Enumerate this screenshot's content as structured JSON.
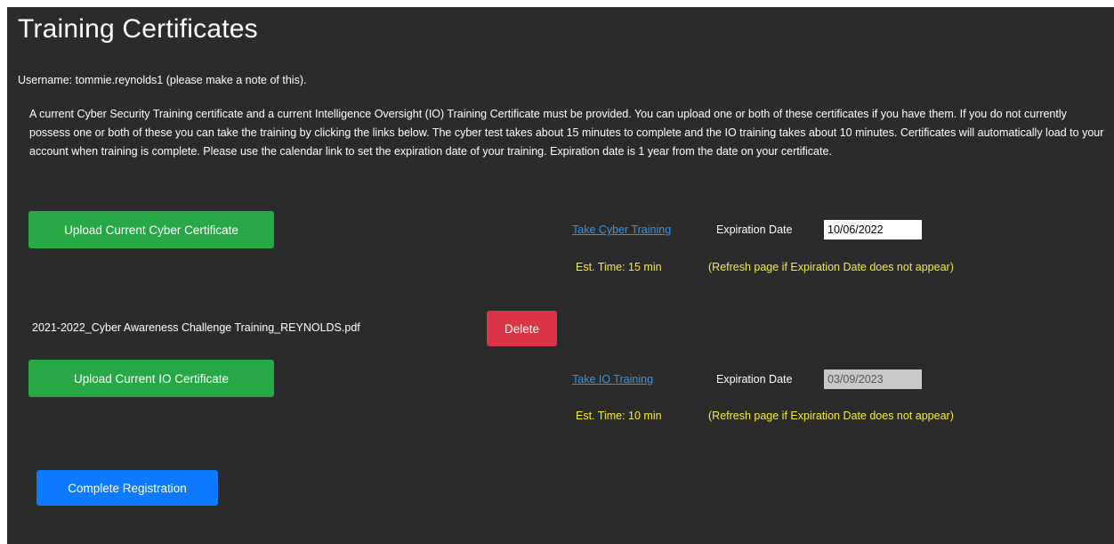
{
  "page": {
    "title": "Training Certificates",
    "username_text": "Username: tommie.reynolds1 (please make a note of this).",
    "description": "A current Cyber Security Training certificate and a current Intelligence Oversight (IO) Training Certificate must be provided. You can upload one or both of these certificates if you have them. If you do not currently possess one or both of these you can take the training by clicking the links below. The cyber test takes about 15 minutes to complete and the IO training takes about 10 minutes. Certificates will automatically load to your account when training is complete. Please use the calendar link to set the expiration date of your training. Expiration date is 1 year from the date on your certificate."
  },
  "cyber": {
    "upload_label": "Upload Current Cyber Certificate",
    "training_link": "Take Cyber Training",
    "expiration_label": "Expiration Date",
    "expiration_value": "10/06/2022",
    "est_time": "Est. Time: 15 min",
    "refresh_note": "(Refresh page if Expiration Date does not appear)",
    "uploaded_file": "2021-2022_Cyber Awareness Challenge Training_REYNOLDS.pdf",
    "delete_label": "Delete"
  },
  "io": {
    "upload_label": "Upload Current IO Certificate",
    "training_link": "Take IO Training",
    "expiration_label": "Expiration Date",
    "expiration_value": "03/09/2023",
    "est_time": "Est. Time: 10 min",
    "refresh_note": "(Refresh page if Expiration Date does not appear)"
  },
  "footer": {
    "complete_label": "Complete Registration"
  },
  "colors": {
    "background": "#2b2b2b",
    "green_button": "#28a745",
    "red_button": "#dc3545",
    "blue_button": "#0d7bff",
    "note_text": "#f5ec3c",
    "link": "#3a94e0"
  }
}
